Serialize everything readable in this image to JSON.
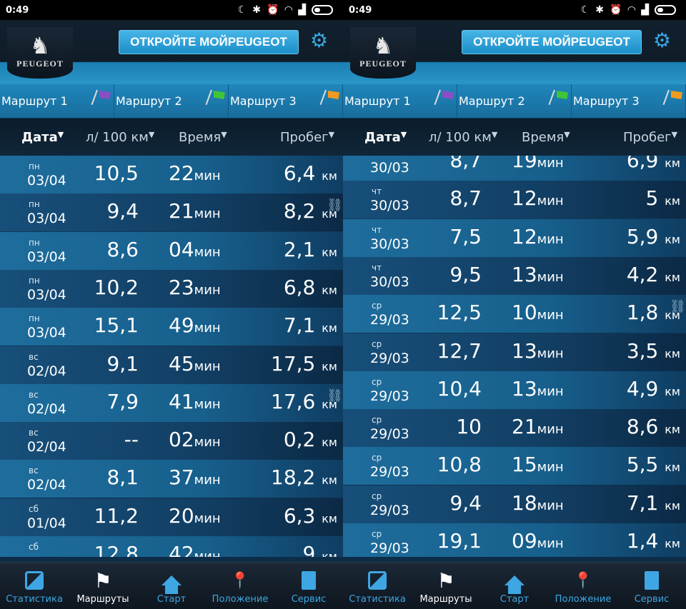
{
  "statusbar": {
    "time": "0:49",
    "icons": [
      "moon-icon",
      "bluetooth-icon",
      "alarm-icon",
      "wifi-icon",
      "signal-icon",
      "battery-icon"
    ]
  },
  "header": {
    "brand": "PEUGEOT",
    "open_button": "ОТКРОЙТЕ МОЙPEUGEOT",
    "settings_icon": "gear-icon"
  },
  "routes": [
    {
      "label": "Маршрут 1",
      "flag_color": "#8a4fc4"
    },
    {
      "label": "Маршрут 2",
      "flag_color": "#3fc43a"
    },
    {
      "label": "Маршрут 3",
      "flag_color": "#f29a1e"
    }
  ],
  "columns": {
    "date": "Дата",
    "consumption": "л/ 100 км",
    "time": "Время",
    "distance": "Пробег"
  },
  "units": {
    "min": "мин",
    "km": "км"
  },
  "left_rows": [
    {
      "day": "пн",
      "date": "03/04",
      "cons": "10,5",
      "time": "22",
      "dist": "6,4"
    },
    {
      "day": "пн",
      "date": "03/04",
      "cons": "9,4",
      "time": "21",
      "dist": "8,2",
      "linked": true
    },
    {
      "day": "пн",
      "date": "03/04",
      "cons": "8,6",
      "time": "04",
      "dist": "2,1"
    },
    {
      "day": "пн",
      "date": "03/04",
      "cons": "10,2",
      "time": "23",
      "dist": "6,8"
    },
    {
      "day": "пн",
      "date": "03/04",
      "cons": "15,1",
      "time": "49",
      "dist": "7,1"
    },
    {
      "day": "вс",
      "date": "02/04",
      "cons": "9,1",
      "time": "45",
      "dist": "17,5"
    },
    {
      "day": "вс",
      "date": "02/04",
      "cons": "7,9",
      "time": "41",
      "dist": "17,6",
      "linked": true
    },
    {
      "day": "вс",
      "date": "02/04",
      "cons": "--",
      "time": "02",
      "dist": "0,2"
    },
    {
      "day": "вс",
      "date": "02/04",
      "cons": "8,1",
      "time": "37",
      "dist": "18,2"
    },
    {
      "day": "сб",
      "date": "01/04",
      "cons": "11,2",
      "time": "20",
      "dist": "6,3"
    },
    {
      "day": "сб",
      "date": "",
      "cons": "12,8",
      "time": "42",
      "dist": "9"
    }
  ],
  "right_rows": [
    {
      "day": "",
      "date": "30/03",
      "cons": "8,7",
      "time": "19",
      "dist": "6,9"
    },
    {
      "day": "чт",
      "date": "30/03",
      "cons": "8,7",
      "time": "12",
      "dist": "5"
    },
    {
      "day": "чт",
      "date": "30/03",
      "cons": "7,5",
      "time": "12",
      "dist": "5,9"
    },
    {
      "day": "чт",
      "date": "30/03",
      "cons": "9,5",
      "time": "13",
      "dist": "4,2"
    },
    {
      "day": "ср",
      "date": "29/03",
      "cons": "12,5",
      "time": "10",
      "dist": "1,8",
      "linked": true
    },
    {
      "day": "ср",
      "date": "29/03",
      "cons": "12,7",
      "time": "13",
      "dist": "3,5"
    },
    {
      "day": "ср",
      "date": "29/03",
      "cons": "10,4",
      "time": "13",
      "dist": "4,9"
    },
    {
      "day": "ср",
      "date": "29/03",
      "cons": "10",
      "time": "21",
      "dist": "8,6"
    },
    {
      "day": "ср",
      "date": "29/03",
      "cons": "10,8",
      "time": "15",
      "dist": "5,5"
    },
    {
      "day": "ср",
      "date": "29/03",
      "cons": "9,4",
      "time": "18",
      "dist": "7,1"
    },
    {
      "day": "ср",
      "date": "29/03",
      "cons": "19,1",
      "time": "09",
      "dist": "1,4"
    }
  ],
  "bottomnav": [
    {
      "label": "Статистика",
      "icon": "chart-icon"
    },
    {
      "label": "Маршруты",
      "icon": "flag-icon",
      "active": true
    },
    {
      "label": "Старт",
      "icon": "home-icon"
    },
    {
      "label": "Положение",
      "icon": "location-car-icon"
    },
    {
      "label": "Сервис",
      "icon": "service-book-icon"
    }
  ]
}
